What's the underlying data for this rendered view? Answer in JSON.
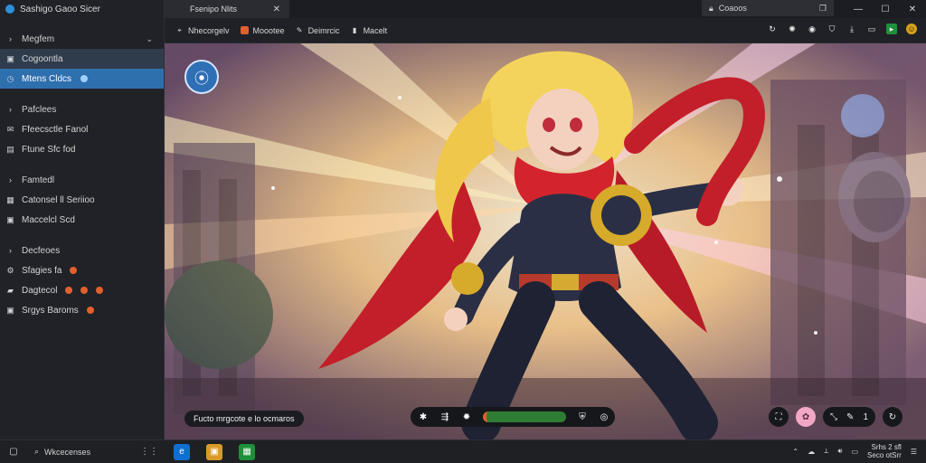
{
  "sidebar": {
    "title": "Sashigo Gaoo Sicer",
    "groups": [
      {
        "header": "Megfem",
        "items": [
          {
            "label": "Cogoontla",
            "icon": "image-icon",
            "state": "selected"
          },
          {
            "label": "Mtens Cldcs",
            "icon": "clock-icon",
            "state": "active"
          }
        ]
      },
      {
        "header": "Pafclees",
        "items": [
          {
            "label": "Ffeecsctle Fanol",
            "icon": "chat-icon"
          },
          {
            "label": "Ftune Sfc fod",
            "icon": "doc-icon"
          }
        ]
      },
      {
        "header": "Famtedl",
        "items": [
          {
            "label": "Catonsel ll Seriioo",
            "icon": "photo-icon"
          },
          {
            "label": "Maccelcl Scd",
            "icon": "image-icon"
          }
        ]
      },
      {
        "header": "Decfeoes",
        "items": [
          {
            "label": "Sfagies fa",
            "icon": "gear-icon",
            "dots": 1
          },
          {
            "label": "Dagtecol",
            "icon": "folder-icon",
            "dots": 3
          },
          {
            "label": "Srgys Baroms",
            "icon": "image-icon",
            "dots": 1
          }
        ]
      }
    ]
  },
  "tabs": {
    "active_tab": "Fsenipo Nlits"
  },
  "address": {
    "text": "Coaoos"
  },
  "toolbar": {
    "items": [
      "Nhecorgelv",
      "Moootee",
      "Deimrcic",
      "Macelt"
    ]
  },
  "content": {
    "caption": "Fucto mrgcote e lo ocmaros",
    "media": {
      "value": "1"
    }
  },
  "taskbar": {
    "search_text": "Wkcecenses",
    "clock_line1": "Srhs 2 sfl",
    "clock_line2": "Seco otSrr"
  },
  "colors": {
    "accent": "#2e6fae",
    "orange": "#e0612d",
    "green": "#1f8f3a",
    "yellow": "#d7a21a"
  }
}
